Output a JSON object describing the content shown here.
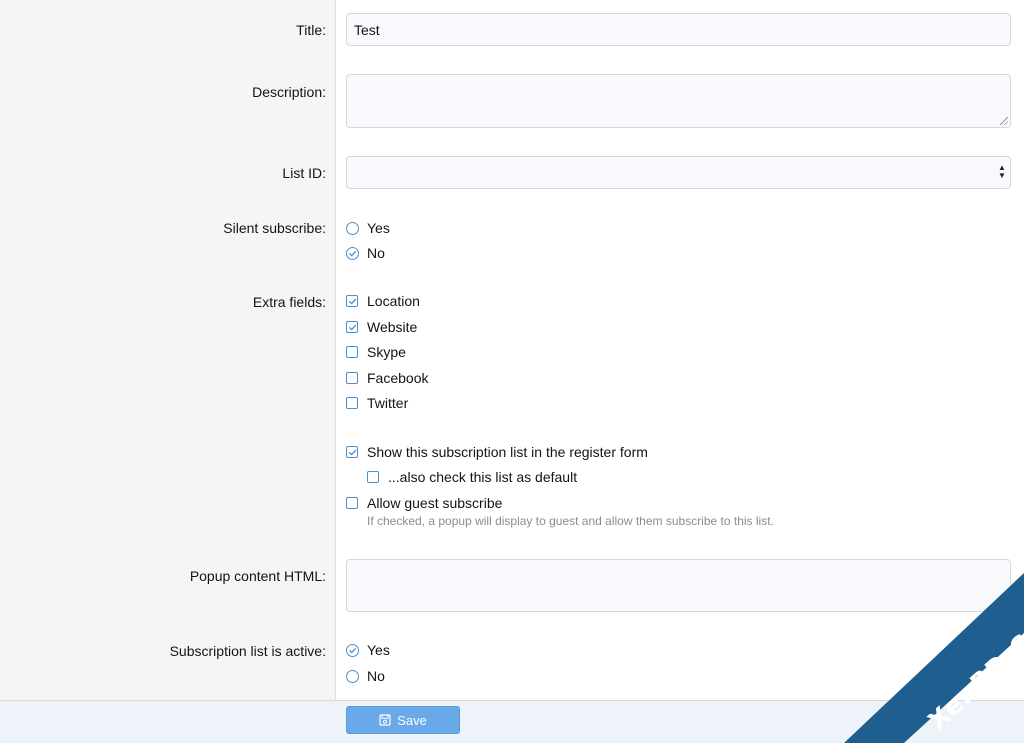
{
  "labels": {
    "title": "Title:",
    "description": "Description:",
    "list_id": "List ID:",
    "silent_subscribe": "Silent subscribe:",
    "extra_fields": "Extra fields:",
    "popup_content": "Popup content HTML:",
    "active": "Subscription list is active:"
  },
  "fields": {
    "title_value": "Test",
    "description_value": "",
    "list_id_value": "",
    "popup_value": ""
  },
  "silent_subscribe": {
    "options": [
      "Yes",
      "No"
    ],
    "selected": "No"
  },
  "extra_fields": {
    "items": [
      {
        "label": "Location",
        "checked": true
      },
      {
        "label": "Website",
        "checked": true
      },
      {
        "label": "Skype",
        "checked": false
      },
      {
        "label": "Facebook",
        "checked": false
      },
      {
        "label": "Twitter",
        "checked": false
      }
    ]
  },
  "register": {
    "show_label": "Show this subscription list in the register form",
    "show_checked": true,
    "default_label": "...also check this list as default",
    "default_checked": false,
    "guest_label": "Allow guest subscribe",
    "guest_checked": false,
    "guest_hint": "If checked, a popup will display to guest and allow them subscribe to this list."
  },
  "active": {
    "options": [
      "Yes",
      "No"
    ],
    "selected": "Yes"
  },
  "footer": {
    "save_label": "Save"
  },
  "watermark": {
    "text": "XenBD.Com"
  },
  "colors": {
    "accent": "#4a90cf",
    "button": "#6aa9e9",
    "label_bg": "#f5f5f5",
    "input_bg": "#f7f9fc",
    "watermark": "#1f5f8f"
  },
  "icons": [
    "select-arrows-icon",
    "radio-checked-icon",
    "checkbox-checked-icon",
    "save-icon"
  ]
}
